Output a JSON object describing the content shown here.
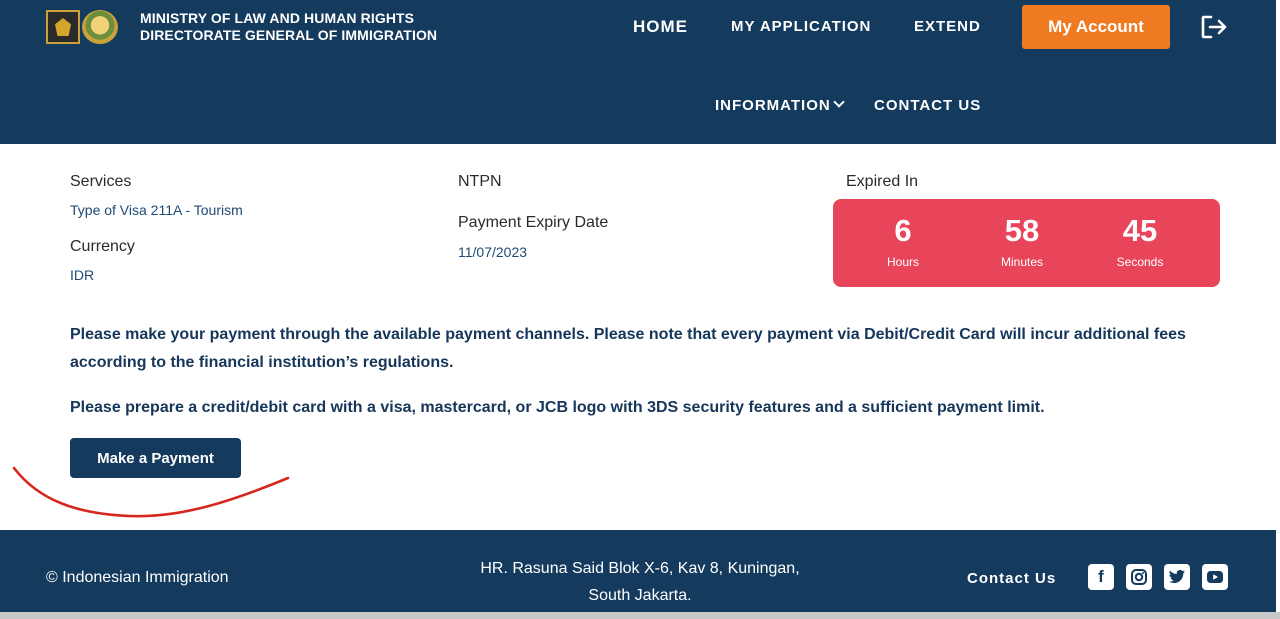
{
  "header": {
    "brand_line1": "MINISTRY OF  LAW  AND HUMAN RIGHTS",
    "brand_line2": "DIRECTORATE GENERAL OF IMMIGRATION",
    "nav": {
      "home": "HOME",
      "my_application": "MY APPLICATION",
      "extend": "EXTEND",
      "information": "INFORMATION",
      "contact_us": "CONTACT US"
    },
    "account_button": "My Account",
    "colors": {
      "navy": "#143a5e",
      "accent": "#f07a22"
    }
  },
  "details": {
    "services_label": "Services",
    "services_value": "Type of Visa 211A - Tourism",
    "currency_label": "Currency",
    "currency_value": "IDR",
    "ntpn_label": "NTPN",
    "expiry_label": "Payment Expiry Date",
    "expiry_value": "11/07/2023",
    "expired_in_label": "Expired In"
  },
  "countdown": {
    "hours": "6",
    "hours_label": "Hours",
    "minutes": "58",
    "minutes_label": "Minutes",
    "seconds": "45",
    "seconds_label": "Seconds",
    "color": "#e8455b"
  },
  "notices": {
    "fees": "Please make your payment through the available payment channels. Please note that every payment via Debit/Credit Card will incur additional fees according to the financial institution’s regulations.",
    "card": "Please prepare a credit/debit card with a visa, mastercard, or JCB logo with 3DS security features and a sufficient payment limit."
  },
  "payment_button": "Make a Payment",
  "footer": {
    "copyright": "© Indonesian Immigration",
    "address_line1": "HR. Rasuna Said Blok X-6, Kav 8, Kuningan,",
    "address_line2": "South Jakarta.",
    "contact_label": "Contact Us",
    "social_icons": [
      "facebook-icon",
      "instagram-icon",
      "twitter-icon",
      "youtube-icon"
    ]
  }
}
